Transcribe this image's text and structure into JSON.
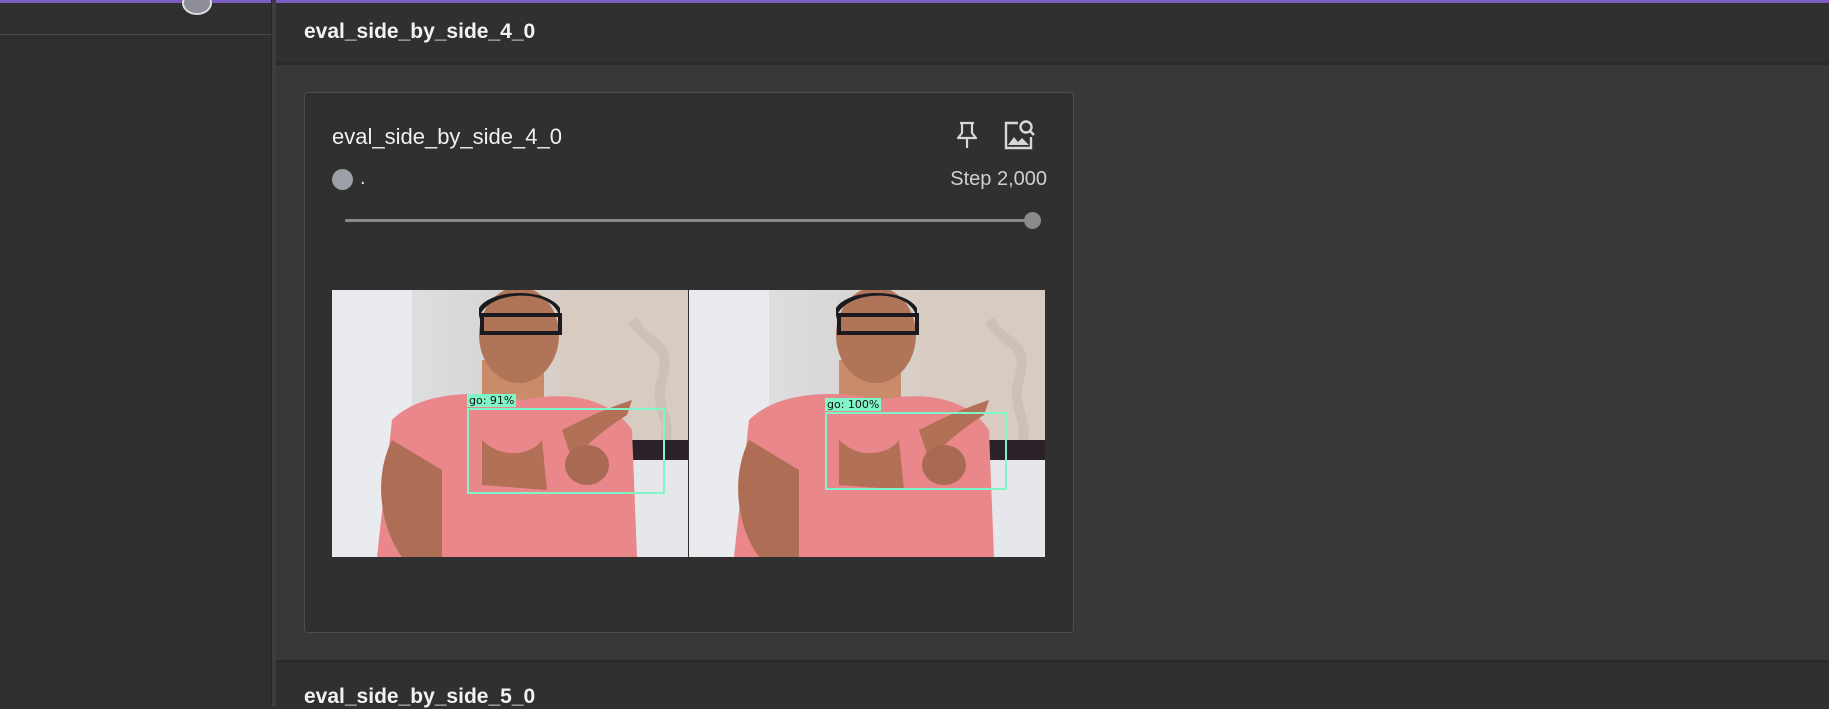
{
  "theme": {
    "accent": "#7c5cbf",
    "detection_color": "#7ff5c8",
    "run_color": "#9aa0a6"
  },
  "groups": [
    {
      "title": "eval_side_by_side_4_0"
    },
    {
      "title": "eval_side_by_side_5_0"
    }
  ],
  "card": {
    "title": "eval_side_by_side_4_0",
    "icons": {
      "pin": "pin-icon",
      "expand": "image-search-icon"
    },
    "run_name": ".",
    "step_label": "Step 2,000",
    "slider_fraction": 1.0,
    "detections": [
      {
        "label": "go: 91%"
      },
      {
        "label": "go: 100%"
      }
    ]
  }
}
